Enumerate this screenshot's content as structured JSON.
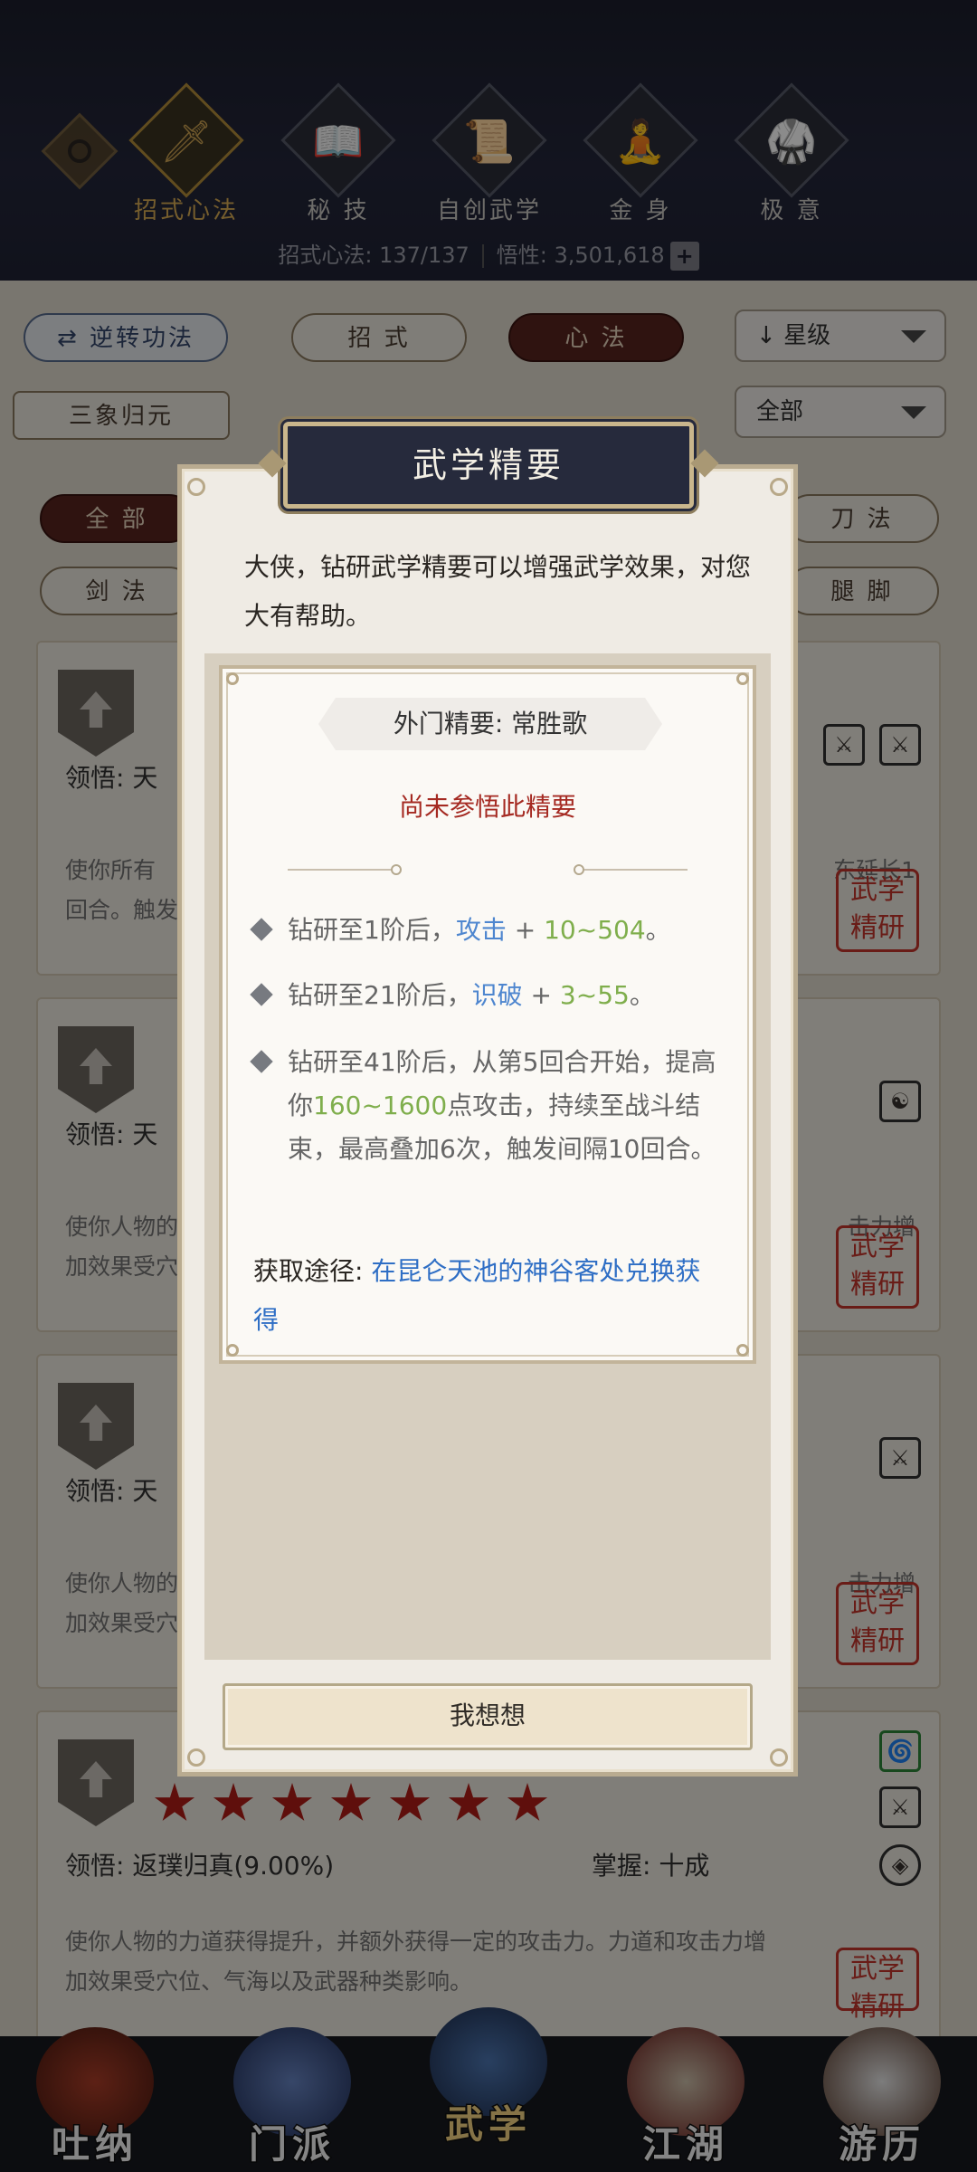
{
  "top_tabs": [
    {
      "label": "招式心法",
      "icon": "sword-icon",
      "active": true
    },
    {
      "label": "秘 技",
      "icon": "book-icon",
      "active": false
    },
    {
      "label": "自创武学",
      "icon": "scroll-icon",
      "active": false
    },
    {
      "label": "金 身",
      "icon": "meditation-icon",
      "active": false
    },
    {
      "label": "极 意",
      "icon": "martial-pose-icon",
      "active": false
    }
  ],
  "stats": {
    "moves_label": "招式心法: 137/137",
    "insight_label": "悟性: 3,501,618",
    "plus": "+"
  },
  "filters": {
    "reverse": "逆转功法",
    "moves": "招 式",
    "heart": "心 法",
    "sort": "星级",
    "sort_arrow": "↓",
    "combo": "三象归元",
    "scope": "全部",
    "all": "全 部",
    "sword": "剑 法",
    "blade": "刀 法",
    "kick": "腿 脚"
  },
  "cards": [
    {
      "lw": "领悟: 天",
      "desc": "使你所有",
      "desc_end": "东延长1",
      "desc2": "回合。触发"
    },
    {
      "lw": "领悟: 天",
      "desc": "使你人物的",
      "desc_end": "击力增",
      "desc2": "加效果受穴"
    },
    {
      "lw": "领悟: 天",
      "desc": "使你人物的",
      "desc_end": "击力增",
      "desc2": "加效果受穴"
    },
    {
      "lw": "领悟: 返璞归真(9.00%)",
      "mastery": "掌握: 十成",
      "desc": "使你人物的力道获得提升，并额外获得一定的攻击力。力道和攻击力增",
      "desc2": "加效果受穴位、气海以及武器种类影响。",
      "stars": 7
    }
  ],
  "seal_text": "武学精研",
  "dialog": {
    "title": "武学精要",
    "intro": "大侠，钻研武学精要可以增强武学效果，对您大有帮助。",
    "subtitle": "外门精要: 常胜歌",
    "status": "尚未参悟此精要",
    "effects": [
      {
        "pre": "钻研至1阶后，",
        "stat": "攻击",
        "mid": " + ",
        "value": "10~504",
        "post": "。"
      },
      {
        "pre": "钻研至21阶后，",
        "stat": "识破",
        "mid": " + ",
        "value": "3~55",
        "post": "。"
      },
      {
        "pre": "钻研至41阶后，从第5回合开始，提高你",
        "value": "160~1600",
        "post": "点攻击，持续至战斗结束，最高叠加6次，触发间隔10回合。"
      }
    ],
    "source_label": "获取途径: ",
    "source_value": "在昆仑天池的神谷客处兑换获得",
    "button": "我想想"
  },
  "nav": [
    {
      "label": "吐纳"
    },
    {
      "label": "门派"
    },
    {
      "label": "武学"
    },
    {
      "label": "江湖"
    },
    {
      "label": "游历"
    }
  ],
  "colors": {
    "accent_gold": "#caa050",
    "status_red": "#a52a22",
    "stat_blue": "#4e86cf",
    "value_green": "#7fae4c"
  }
}
